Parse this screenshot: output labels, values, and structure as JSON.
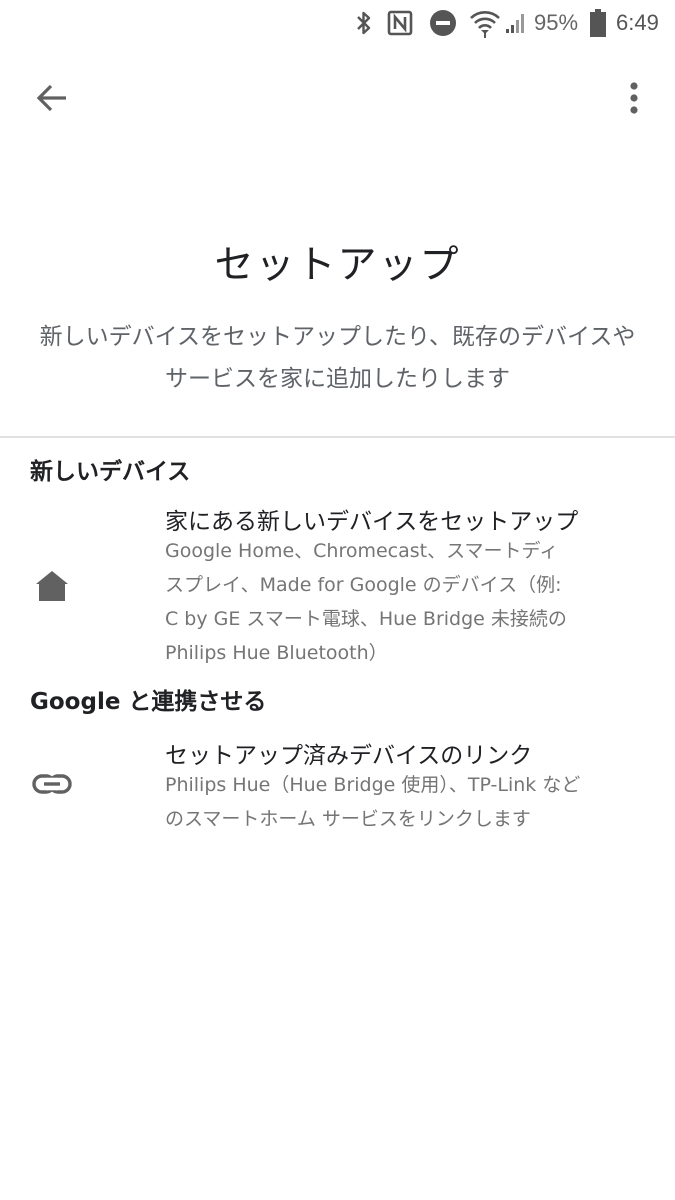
{
  "status_bar": {
    "icons": [
      "bluetooth-icon",
      "nfc-icon",
      "do-not-disturb-icon",
      "wifi-icon",
      "cellular-signal-icon",
      "battery-icon"
    ],
    "battery_percent": "95%",
    "time": "6:49"
  },
  "app_bar": {
    "back_icon": "arrow-back-icon",
    "menu_icon": "more-vert-icon"
  },
  "header": {
    "title": "セットアップ",
    "subtitle_lines": [
      "新しいデバイスをセットアップしたり、既存のデバイスや",
      "サービスを家に追加したりします"
    ]
  },
  "sections": [
    {
      "header": "新しいデバイス",
      "item": {
        "icon": "home-icon",
        "title": "家にある新しいデバイスをセットアップ",
        "description_lines": [
          "Google Home、Chromecast、スマートディ",
          "スプレイ、Made for Google のデバイス（例:",
          "C by GE スマート電球、Hue Bridge 未接続の",
          "Philips Hue Bluetooth）"
        ]
      }
    },
    {
      "header": "Google と連携させる",
      "item": {
        "icon": "link-icon",
        "title": "セットアップ済みデバイスのリンク",
        "description_lines": [
          "Philips Hue（Hue Bridge 使用）、TP-Link など",
          "のスマートホーム サービスをリンクします"
        ]
      }
    }
  ],
  "colors": {
    "primary_text": "#202124",
    "secondary_text": "#757575",
    "icon": "#616161",
    "divider": "#e0e0e0",
    "background": "#ffffff"
  }
}
